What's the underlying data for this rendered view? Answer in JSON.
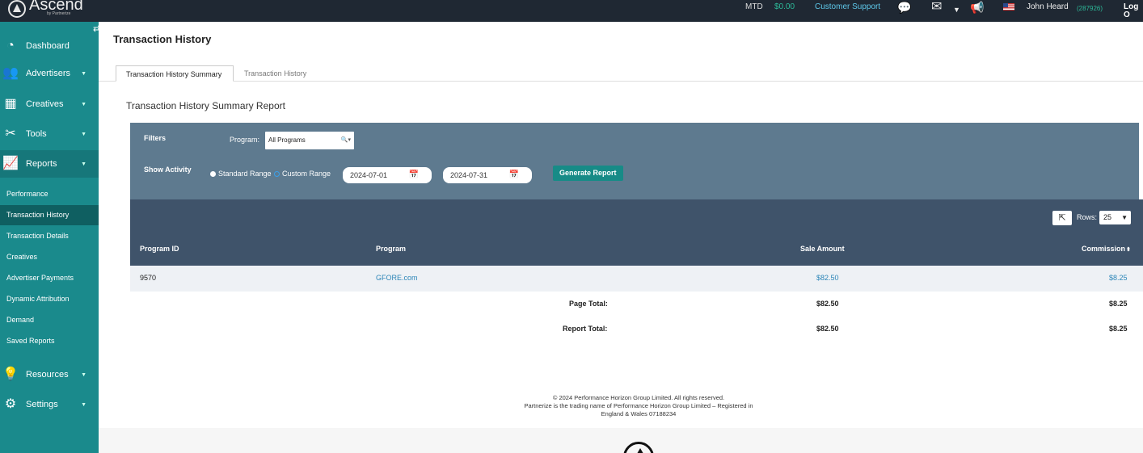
{
  "topbar": {
    "logo": "Ascend",
    "logo_sub": "by Partnerize",
    "mtd_label": "MTD",
    "mtd_value": "$0.00",
    "support": "Customer Support",
    "username": "John Heard",
    "user_id": "(287926)",
    "logout": "Log O"
  },
  "sidebar": {
    "items": [
      {
        "label": "Dashboard",
        "icon": "dashboard-icon"
      },
      {
        "label": "Advertisers",
        "icon": "users-icon"
      },
      {
        "label": "Creatives",
        "icon": "layout-icon"
      },
      {
        "label": "Tools",
        "icon": "tools-icon"
      },
      {
        "label": "Reports",
        "icon": "chart-icon"
      },
      {
        "label": "Resources",
        "icon": "lightbulb-icon"
      },
      {
        "label": "Settings",
        "icon": "gear-icon"
      }
    ],
    "sub_items": [
      {
        "label": "Performance"
      },
      {
        "label": "Transaction History"
      },
      {
        "label": "Transaction Details"
      },
      {
        "label": "Creatives"
      },
      {
        "label": "Advertiser Payments"
      },
      {
        "label": "Dynamic Attribution"
      },
      {
        "label": "Demand"
      },
      {
        "label": "Saved Reports"
      }
    ]
  },
  "main": {
    "title": "Transaction History",
    "tabs": [
      {
        "label": "Transaction History Summary"
      },
      {
        "label": "Transaction History"
      }
    ],
    "report_title": "Transaction History Summary Report"
  },
  "filters": {
    "label": "Filters",
    "program_label": "Program:",
    "program_value": "All Programs",
    "activity_label": "Show Activity",
    "standard_range": "Standard Range",
    "custom_range": "Custom Range",
    "start_date": "2024-07-01",
    "end_date": "2024-07-31",
    "generate": "Generate Report"
  },
  "table": {
    "rows_label": "Rows:",
    "rows_value": "25",
    "headers": {
      "program_id": "Program ID",
      "program": "Program",
      "sale_amount": "Sale Amount",
      "commission": "Commission"
    },
    "rows": [
      {
        "program_id": "9570",
        "program": "GFORE.com",
        "sale_amount": "$82.50",
        "commission": "$8.25"
      }
    ],
    "page_total_label": "Page Total:",
    "page_total_sale": "$82.50",
    "page_total_commission": "$8.25",
    "report_total_label": "Report Total:",
    "report_total_sale": "$82.50",
    "report_total_commission": "$8.25"
  },
  "footer": {
    "line1": "© 2024 Performance Horizon Group Limited. All rights reserved.",
    "line2": "Partnerize is the trading name of Performance Horizon Group Limited – Registered in",
    "line3": "England & Wales 07188234"
  },
  "colors": {
    "sidebar": "#1a8a8c",
    "topbar": "#1f2833",
    "filters": "#5e7a8f",
    "table_header": "#3f536a",
    "accent": "#178b87",
    "link": "#2d86b8"
  }
}
